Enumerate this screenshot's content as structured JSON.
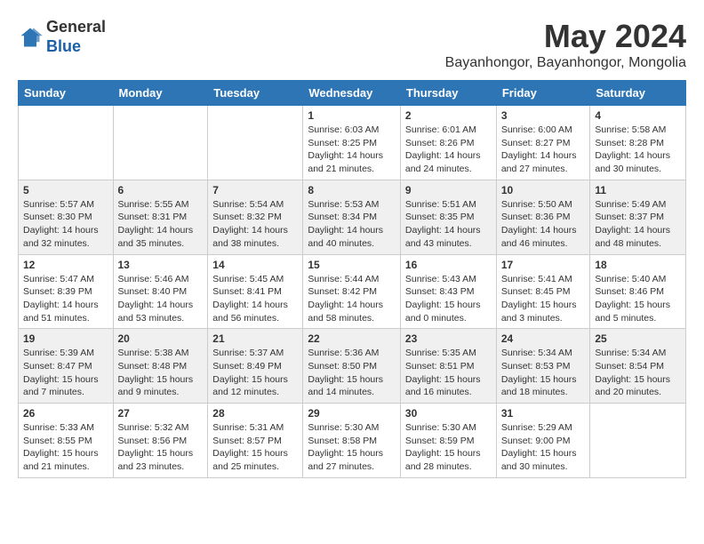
{
  "logo": {
    "general": "General",
    "blue": "Blue"
  },
  "title": {
    "month_year": "May 2024",
    "location": "Bayanhongor, Bayanhongor, Mongolia"
  },
  "days_of_week": [
    "Sunday",
    "Monday",
    "Tuesday",
    "Wednesday",
    "Thursday",
    "Friday",
    "Saturday"
  ],
  "weeks": [
    [
      {
        "day": "",
        "info": ""
      },
      {
        "day": "",
        "info": ""
      },
      {
        "day": "",
        "info": ""
      },
      {
        "day": "1",
        "info": "Sunrise: 6:03 AM\nSunset: 8:25 PM\nDaylight: 14 hours\nand 21 minutes."
      },
      {
        "day": "2",
        "info": "Sunrise: 6:01 AM\nSunset: 8:26 PM\nDaylight: 14 hours\nand 24 minutes."
      },
      {
        "day": "3",
        "info": "Sunrise: 6:00 AM\nSunset: 8:27 PM\nDaylight: 14 hours\nand 27 minutes."
      },
      {
        "day": "4",
        "info": "Sunrise: 5:58 AM\nSunset: 8:28 PM\nDaylight: 14 hours\nand 30 minutes."
      }
    ],
    [
      {
        "day": "5",
        "info": "Sunrise: 5:57 AM\nSunset: 8:30 PM\nDaylight: 14 hours\nand 32 minutes."
      },
      {
        "day": "6",
        "info": "Sunrise: 5:55 AM\nSunset: 8:31 PM\nDaylight: 14 hours\nand 35 minutes."
      },
      {
        "day": "7",
        "info": "Sunrise: 5:54 AM\nSunset: 8:32 PM\nDaylight: 14 hours\nand 38 minutes."
      },
      {
        "day": "8",
        "info": "Sunrise: 5:53 AM\nSunset: 8:34 PM\nDaylight: 14 hours\nand 40 minutes."
      },
      {
        "day": "9",
        "info": "Sunrise: 5:51 AM\nSunset: 8:35 PM\nDaylight: 14 hours\nand 43 minutes."
      },
      {
        "day": "10",
        "info": "Sunrise: 5:50 AM\nSunset: 8:36 PM\nDaylight: 14 hours\nand 46 minutes."
      },
      {
        "day": "11",
        "info": "Sunrise: 5:49 AM\nSunset: 8:37 PM\nDaylight: 14 hours\nand 48 minutes."
      }
    ],
    [
      {
        "day": "12",
        "info": "Sunrise: 5:47 AM\nSunset: 8:39 PM\nDaylight: 14 hours\nand 51 minutes."
      },
      {
        "day": "13",
        "info": "Sunrise: 5:46 AM\nSunset: 8:40 PM\nDaylight: 14 hours\nand 53 minutes."
      },
      {
        "day": "14",
        "info": "Sunrise: 5:45 AM\nSunset: 8:41 PM\nDaylight: 14 hours\nand 56 minutes."
      },
      {
        "day": "15",
        "info": "Sunrise: 5:44 AM\nSunset: 8:42 PM\nDaylight: 14 hours\nand 58 minutes."
      },
      {
        "day": "16",
        "info": "Sunrise: 5:43 AM\nSunset: 8:43 PM\nDaylight: 15 hours\nand 0 minutes."
      },
      {
        "day": "17",
        "info": "Sunrise: 5:41 AM\nSunset: 8:45 PM\nDaylight: 15 hours\nand 3 minutes."
      },
      {
        "day": "18",
        "info": "Sunrise: 5:40 AM\nSunset: 8:46 PM\nDaylight: 15 hours\nand 5 minutes."
      }
    ],
    [
      {
        "day": "19",
        "info": "Sunrise: 5:39 AM\nSunset: 8:47 PM\nDaylight: 15 hours\nand 7 minutes."
      },
      {
        "day": "20",
        "info": "Sunrise: 5:38 AM\nSunset: 8:48 PM\nDaylight: 15 hours\nand 9 minutes."
      },
      {
        "day": "21",
        "info": "Sunrise: 5:37 AM\nSunset: 8:49 PM\nDaylight: 15 hours\nand 12 minutes."
      },
      {
        "day": "22",
        "info": "Sunrise: 5:36 AM\nSunset: 8:50 PM\nDaylight: 15 hours\nand 14 minutes."
      },
      {
        "day": "23",
        "info": "Sunrise: 5:35 AM\nSunset: 8:51 PM\nDaylight: 15 hours\nand 16 minutes."
      },
      {
        "day": "24",
        "info": "Sunrise: 5:34 AM\nSunset: 8:53 PM\nDaylight: 15 hours\nand 18 minutes."
      },
      {
        "day": "25",
        "info": "Sunrise: 5:34 AM\nSunset: 8:54 PM\nDaylight: 15 hours\nand 20 minutes."
      }
    ],
    [
      {
        "day": "26",
        "info": "Sunrise: 5:33 AM\nSunset: 8:55 PM\nDaylight: 15 hours\nand 21 minutes."
      },
      {
        "day": "27",
        "info": "Sunrise: 5:32 AM\nSunset: 8:56 PM\nDaylight: 15 hours\nand 23 minutes."
      },
      {
        "day": "28",
        "info": "Sunrise: 5:31 AM\nSunset: 8:57 PM\nDaylight: 15 hours\nand 25 minutes."
      },
      {
        "day": "29",
        "info": "Sunrise: 5:30 AM\nSunset: 8:58 PM\nDaylight: 15 hours\nand 27 minutes."
      },
      {
        "day": "30",
        "info": "Sunrise: 5:30 AM\nSunset: 8:59 PM\nDaylight: 15 hours\nand 28 minutes."
      },
      {
        "day": "31",
        "info": "Sunrise: 5:29 AM\nSunset: 9:00 PM\nDaylight: 15 hours\nand 30 minutes."
      },
      {
        "day": "",
        "info": ""
      }
    ]
  ]
}
